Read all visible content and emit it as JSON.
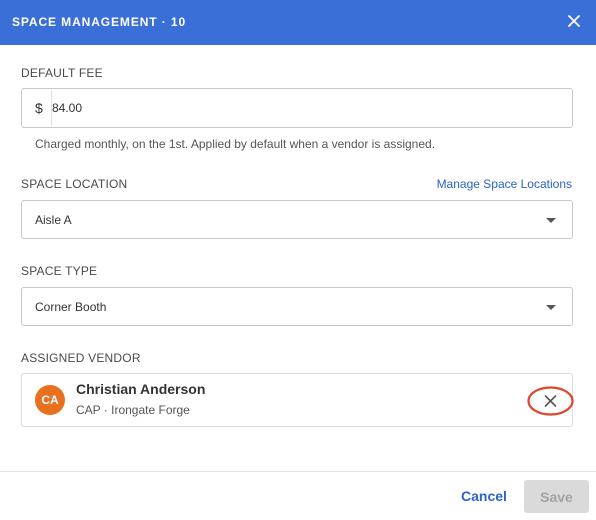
{
  "header": {
    "title": "SPACE MANAGEMENT · 10",
    "close_icon": "close-icon"
  },
  "default_fee": {
    "label": "DEFAULT FEE",
    "currency_symbol": "$",
    "value": "84.00",
    "hint": "Charged monthly, on the 1st. Applied by default when a vendor is assigned."
  },
  "space_location": {
    "label": "SPACE LOCATION",
    "manage_link": "Manage Space Locations",
    "selected": "Aisle A",
    "icon": "chevron-down-icon"
  },
  "space_type": {
    "label": "SPACE TYPE",
    "selected": "Corner Booth",
    "icon": "chevron-down-icon"
  },
  "assigned_vendor": {
    "label": "ASSIGNED VENDOR",
    "initials": "CA",
    "name": "Christian Anderson",
    "meta": "CAP · Irongate Forge",
    "avatar_color": "#e8701f",
    "remove_icon": "close-icon",
    "highlight_color": "#e0442a"
  },
  "footer": {
    "cancel_label": "Cancel",
    "save_label": "Save"
  },
  "colors": {
    "header_bg": "#3a6fd8",
    "link": "#2b63c7",
    "save_disabled_bg": "#dadada"
  }
}
